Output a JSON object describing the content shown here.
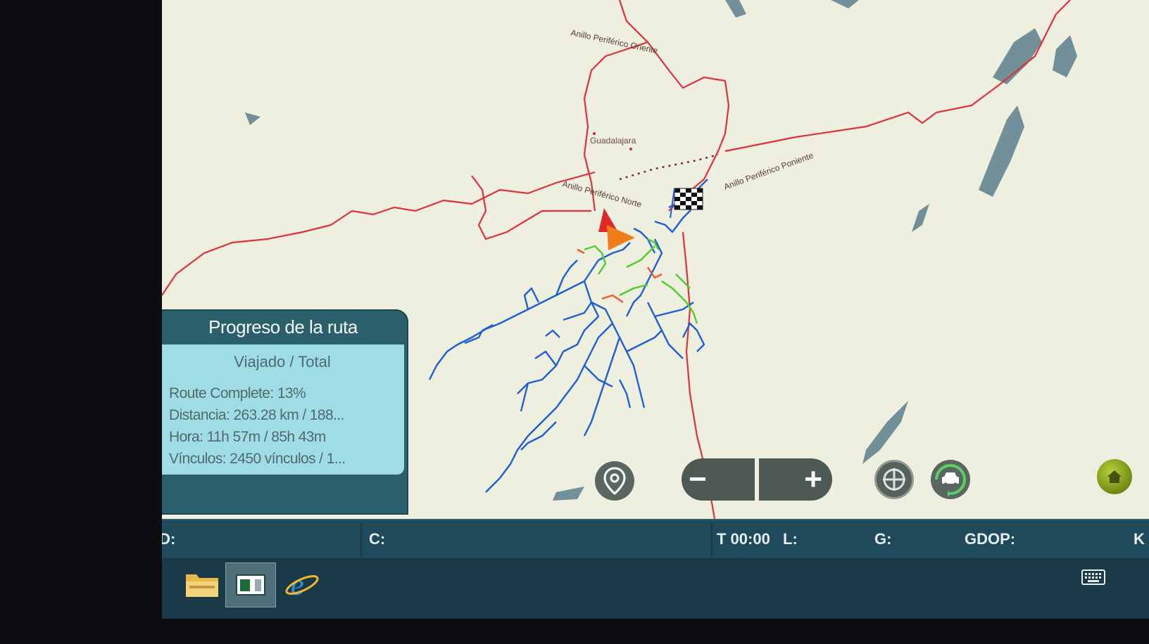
{
  "map": {
    "roads": {
      "ring_east": "Anillo Periférico Oriente",
      "ring_west": "Anillo Periférico Poniente",
      "ring_north": "Anillo Periférico Norte"
    },
    "city": "Guadalajara",
    "colors": {
      "land": "#efefe0",
      "water": "#5a7f8c",
      "road": "#e0303a",
      "route_blue": "#1a5fd6",
      "route_green": "#4ccf2a",
      "route_red": "#ee5a2a"
    },
    "icons": [
      "vehicle-position-icon",
      "finish-flag-icon"
    ]
  },
  "progress": {
    "title": "Progreso de la ruta",
    "subtitle": "Viajado / Total",
    "route_complete": "Route Complete: 13%",
    "distance": "Distancia: 263.28 km / 188...",
    "time": "Hora: 11h 57m / 85h 43m",
    "links": "Vínculos: 2450 vínculos / 1..."
  },
  "controls": {
    "zoom_out": "−",
    "zoom_in": "+",
    "icons": [
      "location-pin-icon",
      "crosshair-icon",
      "vehicle-follow-icon",
      "home-icon"
    ]
  },
  "status": {
    "id_label": "ID:",
    "c_label": "C:",
    "t_label": "T 00:00",
    "l_label": "L:",
    "g_label": "G:",
    "gdop_label": "GDOP:",
    "k_label": "K"
  },
  "taskbar": {
    "icons": [
      "file-explorer-icon",
      "app-window-icon",
      "internet-explorer-icon",
      "keyboard-icon"
    ]
  }
}
